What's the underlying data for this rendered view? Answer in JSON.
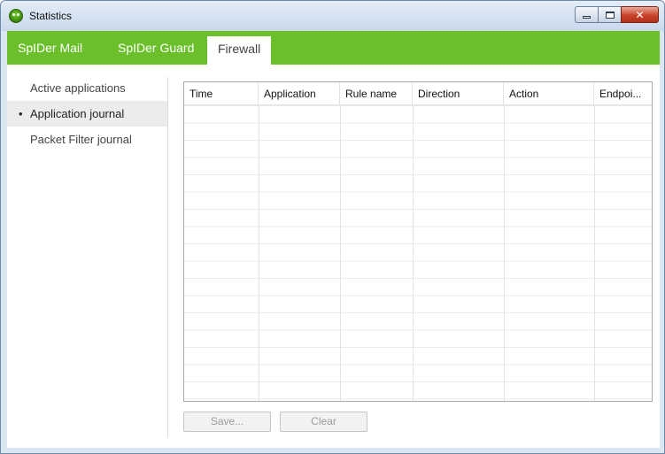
{
  "window": {
    "title": "Statistics",
    "icon": "spider-icon",
    "controls": {
      "minimize": "minimize-icon",
      "maximize": "maximize-icon",
      "close": "close-icon",
      "close_glyph": "✕"
    }
  },
  "colors": {
    "tab_bar": "#6bbf2a",
    "close_button": "#c8432b",
    "selected_item_bg": "#ececec"
  },
  "tabs": [
    {
      "label": "SpIDer Mail",
      "active": false
    },
    {
      "label": "SpIDer Guard",
      "active": false
    },
    {
      "label": "Firewall",
      "active": true
    }
  ],
  "sidebar": {
    "items": [
      {
        "label": "Active applications",
        "selected": false
      },
      {
        "label": "Application journal",
        "selected": true,
        "bullet": "•"
      },
      {
        "label": "Packet Filter journal",
        "selected": false
      }
    ]
  },
  "table": {
    "columns": [
      "Time",
      "Application",
      "Rule name",
      "Direction",
      "Action",
      "Endpoi..."
    ],
    "rows": []
  },
  "buttons": {
    "save": {
      "label": "Save...",
      "enabled": false
    },
    "clear": {
      "label": "Clear",
      "enabled": false
    }
  }
}
